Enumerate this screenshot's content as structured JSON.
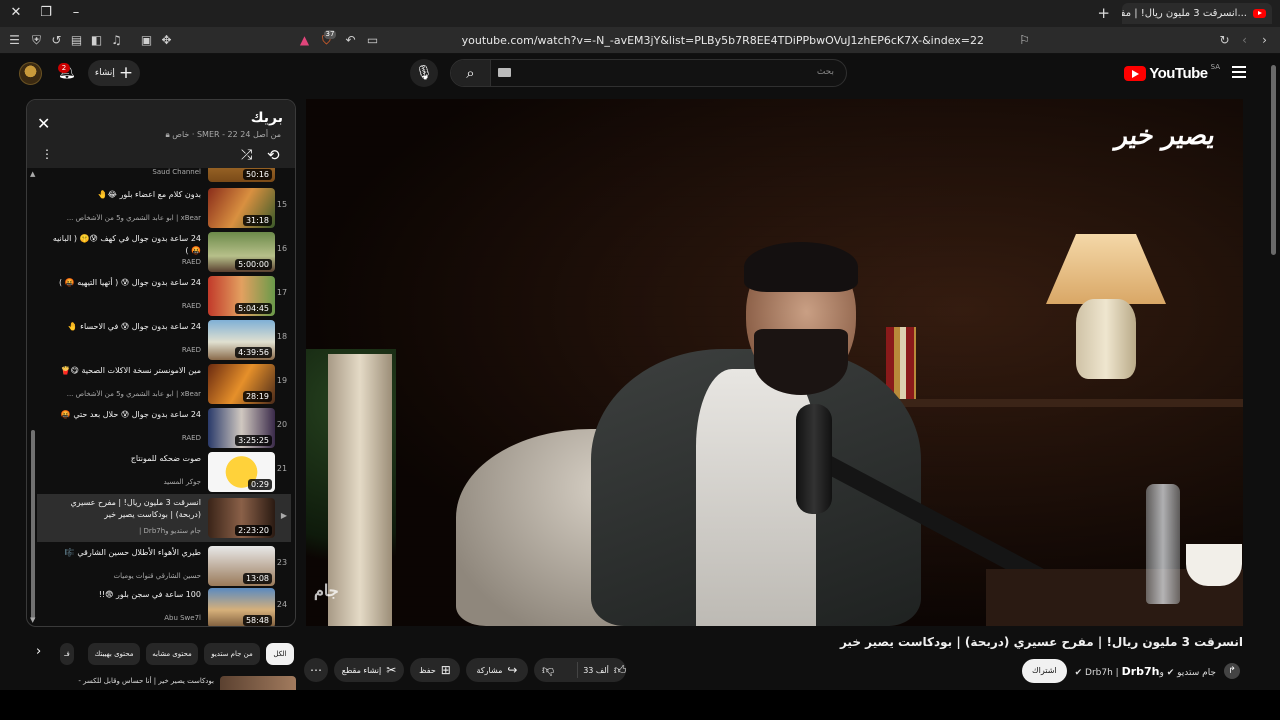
{
  "browser": {
    "tab_title": "(2) انسرقت 3 مليون ريال! | مفر...",
    "url": "youtube.com/watch?v=-N_-avEM3jY&list=PLBy5b7R8EE4TDiPPbwOVuJ1zhEP6cK7X-&index=22",
    "badge_count": "37"
  },
  "header": {
    "logo_text": "YouTube",
    "country_code": "SA",
    "search_placeholder": "بحث",
    "create_label": "إنشاء",
    "notifications": "2"
  },
  "playlist": {
    "title": "بريك",
    "meta_owner": "خاص · SMER",
    "meta_position": "- 22 من أصل 24",
    "items": [
      {
        "index": "14",
        "title": "",
        "channel": "Saud Channel",
        "duration": "50:16"
      },
      {
        "index": "15",
        "title": "بدون كلام مع اعضاء بلور 😂🤚",
        "channel": "xBear | ابو عابد الشمري و5 من الأشخاص ...",
        "duration": "31:18"
      },
      {
        "index": "16",
        "title": "24 ساعة بدون جوال في كهف 😰🤫 ( البانيه 🤬 )",
        "channel": "RAED",
        "duration": "5:00:00"
      },
      {
        "index": "17",
        "title": "24 ساعة بدون جوال 😰 ( أتهيا التيهيه 🤬 )",
        "channel": "RAED",
        "duration": "5:04:45"
      },
      {
        "index": "18",
        "title": "24 ساعة بدون جوال 😰 في الاحساء 🤚",
        "channel": "RAED",
        "duration": "4:39:56"
      },
      {
        "index": "19",
        "title": "مين الامونستر نسخة الاكلات الصحية 😋🍟",
        "channel": "xBear | ابو عابد الشمري و5 من الأشخاص ...",
        "duration": "28:19"
      },
      {
        "index": "20",
        "title": "24 ساعة بدون جوال 😰 حلال بعد حتي 🤬",
        "channel": "RAED",
        "duration": "3:25:25"
      },
      {
        "index": "21",
        "title": "صوت ضحكه للمونتاج",
        "channel": "جوكر المسيد",
        "duration": "0:29"
      },
      {
        "index": "22",
        "title": "انسرقت 3 مليون ريال! | مفرح عسيري (دربحة) | بودكاست يصير خير",
        "channel": "جام ستديو وDrb7h |",
        "duration": "2:23:20"
      },
      {
        "index": "23",
        "title": "طيري الأهواء الأطلال حسين الشارقي 🎼",
        "channel": "حسين الشارقي قنوات يوميات",
        "duration": "13:08"
      },
      {
        "index": "24",
        "title": "100 ساعة في سجن بلور 😨!!",
        "channel": "Abu Swe7l",
        "duration": "58:48"
      }
    ]
  },
  "video": {
    "watermark": "يصير خير",
    "corner_logo": "جام",
    "title": "انسرقت 3 مليون ريال! | مفرح عسيري (دربحة) | بودكاست يصير خير",
    "channel_prefix": "جام ستديو",
    "channel_mid": "وDrb7h |",
    "channel_main": "Drb7h",
    "subscribe_label": "اشتراك",
    "likes": "33 ألف",
    "share_label": "مشاركة",
    "save_label": "حفظ",
    "clip_label": "إنشاء مقطع"
  },
  "chips": [
    {
      "label": "الكل",
      "active": true
    },
    {
      "label": "من جام ستديو",
      "active": false
    },
    {
      "label": "محتوى مشابه",
      "active": false
    },
    {
      "label": "محتوى بهيبتك",
      "active": false
    },
    {
      "label": "فـ",
      "active": false
    }
  ],
  "recommended_peek": "بودكاست يصير خير | أنا حساس وقابل للكسر -"
}
